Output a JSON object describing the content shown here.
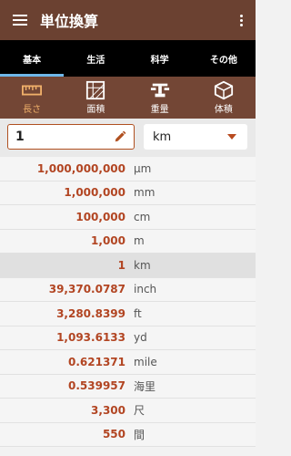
{
  "appbar": {
    "title": "単位換算",
    "menu_icon": "hamburger-menu-icon",
    "more_icon": "more-vert-icon"
  },
  "tabs": [
    {
      "label": "基本",
      "active": true
    },
    {
      "label": "生活",
      "active": false
    },
    {
      "label": "科学",
      "active": false
    },
    {
      "label": "その他",
      "active": false
    }
  ],
  "categories": [
    {
      "label": "長さ",
      "icon": "ruler-icon",
      "active": true
    },
    {
      "label": "面積",
      "icon": "area-grid-icon",
      "active": false
    },
    {
      "label": "重量",
      "icon": "scale-icon",
      "active": false
    },
    {
      "label": "体積",
      "icon": "cube-icon",
      "active": false
    }
  ],
  "input": {
    "value": "1",
    "edit_icon": "pencil-icon"
  },
  "unit_select": {
    "value": "km"
  },
  "results": [
    {
      "value": "1,000,000,000",
      "unit": "μm"
    },
    {
      "value": "1,000,000",
      "unit": "mm"
    },
    {
      "value": "100,000",
      "unit": "cm"
    },
    {
      "value": "1,000",
      "unit": "m"
    },
    {
      "value": "1",
      "unit": "km",
      "selected": true
    },
    {
      "value": "39,370.0787",
      "unit": "inch"
    },
    {
      "value": "3,280.8399",
      "unit": "ft"
    },
    {
      "value": "1,093.6133",
      "unit": "yd"
    },
    {
      "value": "0.621371",
      "unit": "mile"
    },
    {
      "value": "0.539957",
      "unit": "海里"
    },
    {
      "value": "3,300",
      "unit": "尺"
    },
    {
      "value": "550",
      "unit": "間"
    }
  ],
  "colors": {
    "appbar": "#6b4131",
    "accent": "#b24522",
    "tab_indicator": "#6fb7e9",
    "active_category": "#f0b06a"
  }
}
